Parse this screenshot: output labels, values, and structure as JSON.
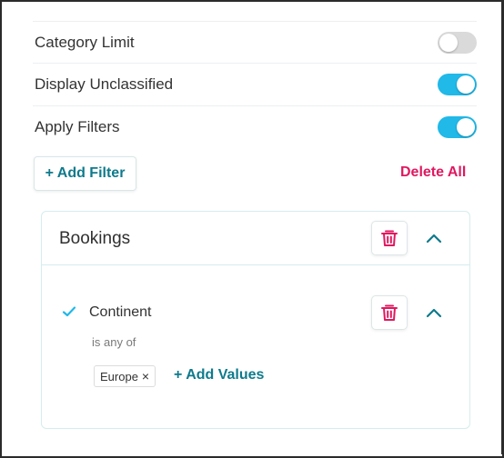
{
  "settings": [
    {
      "label": "Category Limit",
      "enabled": false
    },
    {
      "label": "Display Unclassified",
      "enabled": true
    },
    {
      "label": "Apply Filters",
      "enabled": true
    }
  ],
  "actions": {
    "add_filter_label": "+ Add Filter",
    "delete_all_label": "Delete All"
  },
  "group": {
    "title": "Bookings",
    "condition": {
      "field": "Continent",
      "operator": "is any of",
      "values": [
        {
          "label": "Europe",
          "remove_glyph": "×"
        }
      ],
      "add_values_label": "+ Add Values"
    }
  },
  "colors": {
    "accent": "#0e7a8c",
    "toggle_on": "#20b9e8",
    "toggle_off": "#dadada",
    "danger": "#e0185f",
    "check": "#20b9e8"
  },
  "icons": {
    "delete": "trash-icon",
    "collapse": "chevron-up-icon",
    "selected": "check-icon"
  }
}
